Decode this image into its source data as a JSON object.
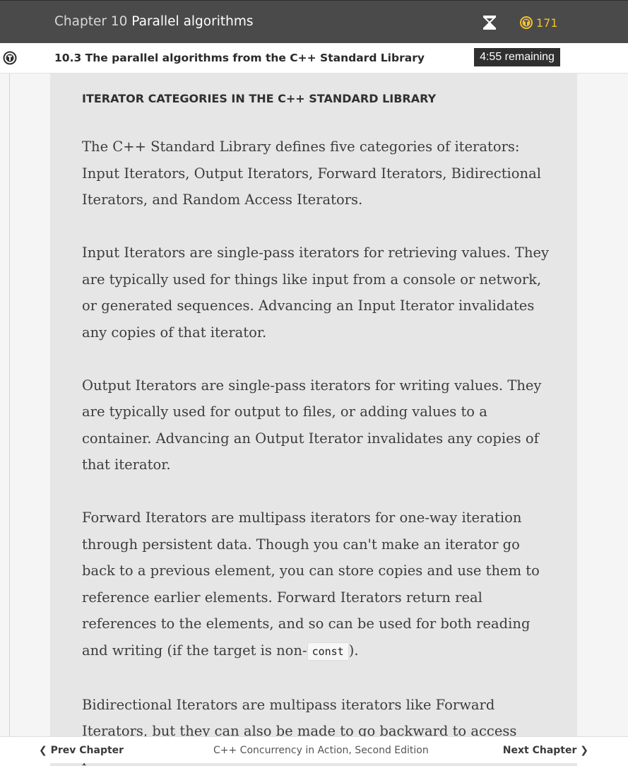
{
  "header": {
    "chapter_prefix": "Chapter 10",
    "chapter_name": "Parallel algorithms",
    "token_count": "171",
    "token_color": "#f2c02f",
    "timer_icon": "hourglass-icon",
    "token_icon": "token-coin-icon"
  },
  "subheader": {
    "section_number": "10.3",
    "section_title": "The parallel algorithms from the C++ Standard Library",
    "time_remaining": "4:55 remaining",
    "logo_icon": "toc-circle-icon"
  },
  "sidebar": {
    "title": "ITERATOR CATEGORIES IN THE C++ STANDARD LIBRARY",
    "p1": "The C++ Standard Library defines five categories of iterators: Input Iterators, Output Iterators, Forward Iterators, Bidirectional Iterators, and Random Access Iterators.",
    "p2": "Input Iterators are single-pass iterators for retrieving values. They are typically used for things like input from a console or network, or generated sequences. Advancing an Input Iterator invalidates any copies of that iterator.",
    "p3": "Output Iterators are single-pass iterators for writing values. They are typically used for output to files, or adding values to a container. Advancing an Output Iterator invalidates any copies of that iterator.",
    "p4_before": "Forward Iterators are multipass iterators for one-way iteration through persistent data. Though you can't make an iterator go back to a previous element, you can store copies and use them to reference earlier elements. Forward Iterators return real references to the elements, and so can be used for both reading and writing (if the target is non-",
    "p4_code": "const",
    "p4_after": ").",
    "p5": "Bidirectional Iterators are multipass iterators like Forward Iterators, but they can also be made to go backward to access previous elements."
  },
  "footer": {
    "prev_label": "Prev Chapter",
    "book_title": "C++ Concurrency in Action, Second Edition",
    "next_label": "Next Chapter"
  }
}
